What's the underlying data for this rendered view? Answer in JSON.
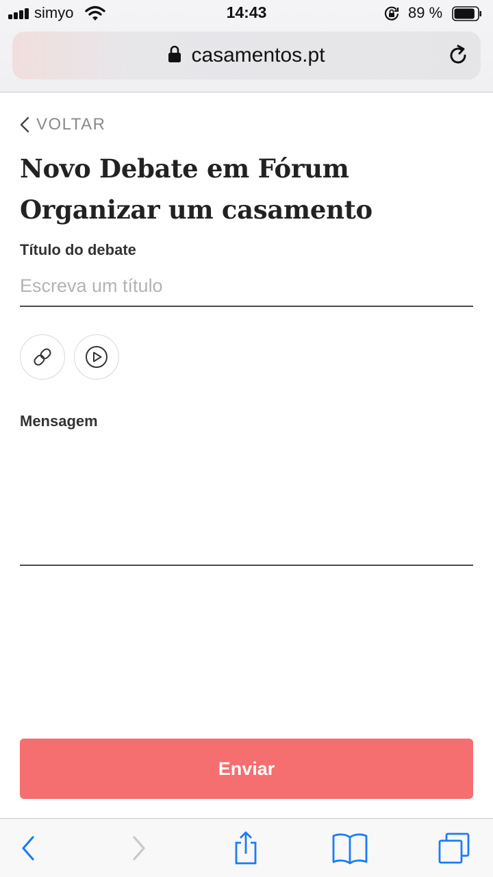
{
  "status_bar": {
    "carrier": "simyo",
    "time": "14:43",
    "battery_percent": "89 %",
    "battery_level": 0.89,
    "icons": [
      "signal-icon",
      "wifi-icon",
      "rotation-lock-icon",
      "battery-icon"
    ]
  },
  "browser": {
    "url": "casamentos.pt",
    "icons": [
      "lock-icon",
      "reload-icon"
    ]
  },
  "page": {
    "back_label": "VOLTAR",
    "title": "Novo Debate em Fórum Organizar um casamento",
    "title_field": {
      "label": "Título do debate",
      "value": "",
      "placeholder": "Escreva um título"
    },
    "tools": [
      "link-icon",
      "play-icon"
    ],
    "message_field": {
      "label": "Mensagem",
      "value": ""
    },
    "submit_label": "Enviar"
  },
  "toolbar": {
    "items": [
      "back-icon",
      "forward-icon",
      "share-icon",
      "bookmarks-icon",
      "tabs-icon"
    ]
  },
  "colors": {
    "accent": "#f56e70",
    "system_blue": "#1a7cf5",
    "muted_text": "#8a8a8a",
    "placeholder": "#b3b3b3"
  }
}
